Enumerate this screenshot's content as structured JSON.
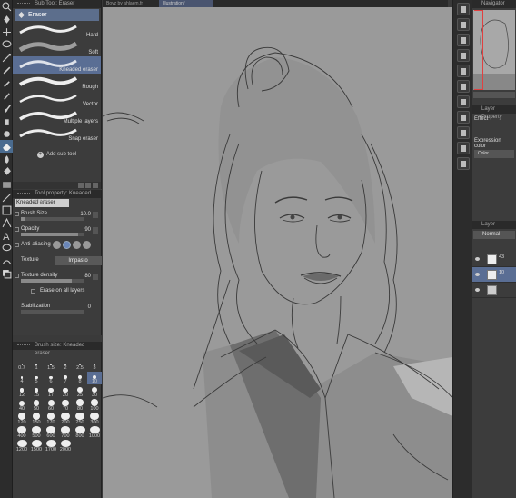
{
  "tabs": [
    {
      "label": "Boyz by ahlaem.fr",
      "active": false
    },
    {
      "label": "Illustration*",
      "active": true
    }
  ],
  "sub_tool": {
    "title": "Sub Tool: Eraser",
    "group": "Eraser",
    "items": [
      {
        "label": "Hard",
        "selected": false
      },
      {
        "label": "Soft",
        "selected": false
      },
      {
        "label": "Kneaded eraser",
        "selected": true
      },
      {
        "label": "Rough",
        "selected": false
      },
      {
        "label": "Vector",
        "selected": false
      },
      {
        "label": "Multiple layers",
        "selected": false
      },
      {
        "label": "Snap eraser",
        "selected": false
      }
    ],
    "add_label": "Add sub tool"
  },
  "tool_property": {
    "title": "Tool property: Kneaded eraser",
    "name": "Kneaded eraser",
    "brush_size_label": "Brush Size",
    "brush_size_value": "10.0",
    "brush_size_fill": 0.05,
    "opacity_label": "Opacity",
    "opacity_value": "90",
    "opacity_fill": 0.9,
    "anti_aliasing_label": "Anti-aliasing",
    "texture_label": "Texture",
    "texture_value": "Impasto",
    "texture_density_label": "Texture density",
    "texture_density_value": "80",
    "texture_density_fill": 0.8,
    "erase_all_label": "Erase on all layers",
    "stabilization_label": "Stabilization",
    "stabilization_value": "0"
  },
  "brush_size": {
    "title": "Brush size: Kneaded eraser",
    "sizes": [
      "0.7",
      "1",
      "1.5",
      "2",
      "2.5",
      "3",
      "4",
      "5",
      "6",
      "7",
      "8",
      "10",
      "12",
      "15",
      "17",
      "20",
      "25",
      "30",
      "40",
      "50",
      "60",
      "70",
      "80",
      "100",
      "120",
      "150",
      "170",
      "200",
      "250",
      "300",
      "400",
      "500",
      "600",
      "700",
      "800",
      "1000",
      "1200",
      "1500",
      "1700",
      "2000"
    ],
    "selected": "10"
  },
  "navigator": {
    "title": "Navigator"
  },
  "layer_property": {
    "title": "Layer Property",
    "effect_label": "Effect",
    "expression_label": "Expression color",
    "expression_value": "Color"
  },
  "layer": {
    "title": "Layer",
    "blend": "Normal",
    "items": [
      {
        "name": "43",
        "selected": false
      },
      {
        "name": "10",
        "selected": true
      },
      {
        "name": "",
        "selected": false
      }
    ]
  }
}
